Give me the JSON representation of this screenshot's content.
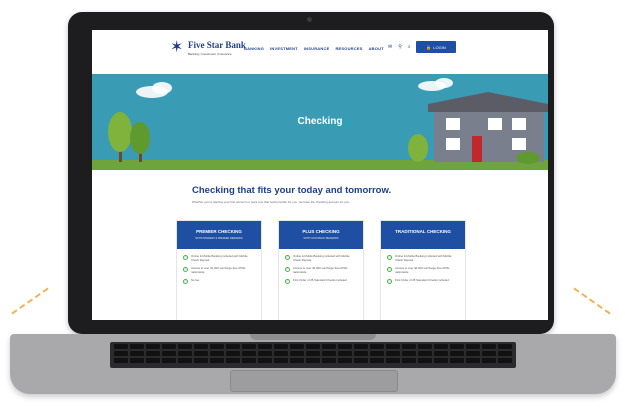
{
  "bank": {
    "name": "Five Star Bank",
    "tagline": "Banking | Investment | Insurance"
  },
  "nav": {
    "items": [
      "BANKING",
      "INVESTMENT",
      "INSURANCE",
      "RESOURCES",
      "ABOUT"
    ],
    "login_label": "LOGIN",
    "icons": [
      "email-icon",
      "location-icon",
      "search-icon"
    ]
  },
  "hero": {
    "title": "Checking"
  },
  "content": {
    "headline": "Checking that fits your today and tomorrow.",
    "intro": "Whether you're starting your first account or want one that works harder for you, we have the checking account for you."
  },
  "cards": [
    {
      "title": "PREMIER CHECKING",
      "subtitle": "WITH INTEREST & PREMIER REWARDS",
      "features": [
        "Online & Mobile Banking included with Mobile Check Deposit",
        "Access to over 40,000 surcharge-free ATMs nationwide",
        "No fee"
      ]
    },
    {
      "title": "PLUS CHECKING",
      "subtitle": "WITH CASH BACK REWARDS",
      "features": [
        "Online & Mobile Banking included with Mobile Check Deposit",
        "Access to over 40,000 surcharge-free ATMs nationwide",
        "First Order of 25 Standard Checks included"
      ]
    },
    {
      "title": "TRADITIONAL CHECKING",
      "subtitle": "",
      "features": [
        "Online & Mobile Banking included with Mobile Check Deposit",
        "Access to over 40,000 surcharge-free ATMs nationwide",
        "First Order of 25 Standard Checks included"
      ]
    }
  ],
  "colors": {
    "brand_blue": "#1f4fa3",
    "hero_teal": "#3a9bb4",
    "check_green": "#4caf50"
  }
}
